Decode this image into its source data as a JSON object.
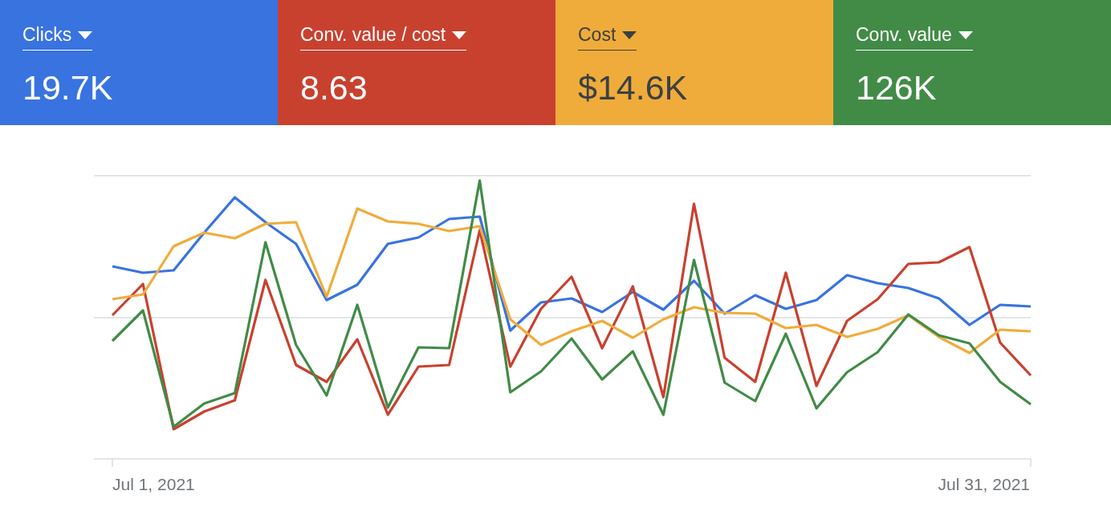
{
  "metrics": [
    {
      "label": "Clicks",
      "value": "19.7K",
      "color": "#3873e0"
    },
    {
      "label": "Conv. value / cost",
      "value": "8.63",
      "color": "#c8412f"
    },
    {
      "label": "Cost",
      "value": "$14.6K",
      "color": "#efac3b"
    },
    {
      "label": "Conv. value",
      "value": "126K",
      "color": "#418b47"
    }
  ],
  "chart": {
    "x_start_label": "Jul 1, 2021",
    "x_end_label": "Jul 31, 2021"
  }
}
